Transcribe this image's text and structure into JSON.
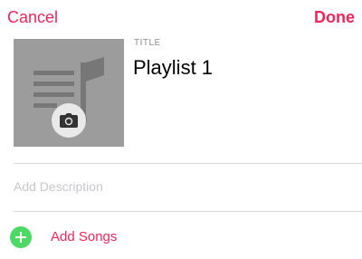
{
  "nav": {
    "cancel_label": "Cancel",
    "done_label": "Done"
  },
  "playlist": {
    "title_caption": "TITLE",
    "title_value": "Playlist 1",
    "description_placeholder": "Add Description",
    "description_value": ""
  },
  "actions": {
    "add_songs_label": "Add Songs"
  },
  "icons": {
    "artwork": "music-note-icon",
    "camera": "camera-icon",
    "add": "plus-icon"
  },
  "colors": {
    "accent": "#f0265a",
    "add_green": "#4cd964",
    "caption_gray": "#8e8e93",
    "artwork_bg": "#9c9c9c",
    "artwork_fg": "#777777"
  }
}
